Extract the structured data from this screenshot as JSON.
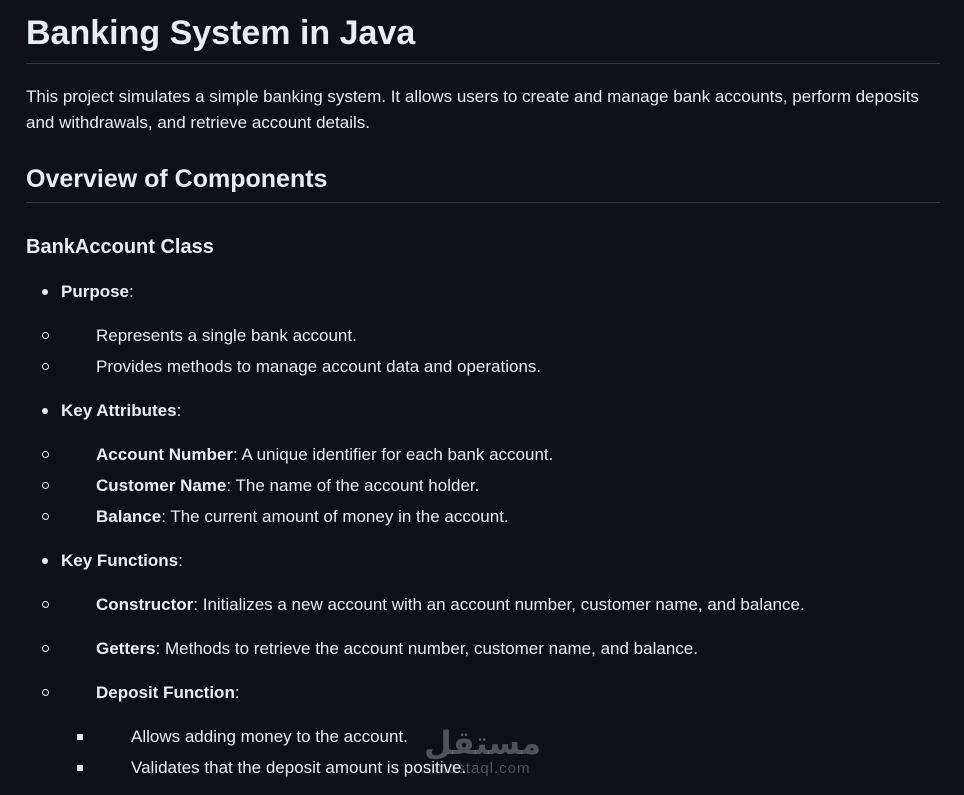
{
  "title": "Banking System in Java",
  "intro": "This project simulates a simple banking system. It allows users to create and manage bank accounts, perform deposits and withdrawals, and retrieve account details.",
  "section_heading": "Overview of Components",
  "subsection_heading": "BankAccount Class",
  "purpose": {
    "label": "Purpose",
    "items": [
      "Represents a single bank account.",
      "Provides methods to manage account data and operations."
    ]
  },
  "attributes": {
    "label": "Key Attributes",
    "items": [
      {
        "term": "Account Number",
        "desc": ": A unique identifier for each bank account."
      },
      {
        "term": "Customer Name",
        "desc": ": The name of the account holder."
      },
      {
        "term": "Balance",
        "desc": ": The current amount of money in the account."
      }
    ]
  },
  "functions": {
    "label": "Key Functions",
    "items": [
      {
        "term": "Constructor",
        "desc": ": Initializes a new account with an account number, customer name, and balance."
      },
      {
        "term": "Getters",
        "desc": ": Methods to retrieve the account number, customer name, and balance."
      },
      {
        "term": "Deposit Function",
        "desc": ":"
      }
    ],
    "deposit_details": [
      "Allows adding money to the account.",
      "Validates that the deposit amount is positive."
    ]
  },
  "watermark": {
    "arabic": "مستقل",
    "latin": "mostaql.com"
  }
}
